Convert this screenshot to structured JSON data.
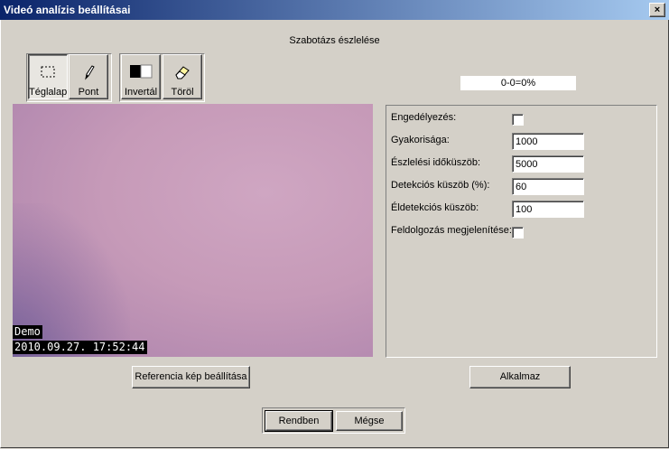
{
  "window": {
    "title": "Videó analízis beállításai",
    "close_glyph": "×"
  },
  "section_title": "Szabotázs észlelése",
  "tools": [
    {
      "label": "Téglalap",
      "icon": "rectangle-select-icon",
      "active": true
    },
    {
      "label": "Pont",
      "icon": "pencil-icon",
      "active": false
    },
    {
      "label": "Invertál",
      "icon": "invert-icon",
      "active": false
    },
    {
      "label": "Töröl",
      "icon": "eraser-icon",
      "active": false
    }
  ],
  "progress_text": "0-0=0%",
  "video": {
    "osd_name": "Demo",
    "osd_timestamp": "2010.09.27. 17:52:44"
  },
  "settings": {
    "enable": {
      "label": "Engedélyezés:",
      "checked": false
    },
    "frequency": {
      "label": "Gyakorisága:",
      "value": "1000"
    },
    "detect_time": {
      "label": "Észlelési időküszöb:",
      "value": "5000"
    },
    "detect_threshold": {
      "label": "Detekciós küszöb (%):",
      "value": "60"
    },
    "edge_threshold": {
      "label": "Éldetekciós küszöb:",
      "value": "100"
    },
    "show_processing": {
      "label": "Feldolgozás megjelenítése:",
      "checked": false
    }
  },
  "buttons": {
    "set_reference": "Referencia kép beállítása",
    "apply": "Alkalmaz",
    "ok": "Rendben",
    "cancel": "Mégse"
  },
  "colors": {
    "title_start": "#0a246a",
    "title_end": "#a6caf0",
    "face": "#d4d0c8"
  }
}
